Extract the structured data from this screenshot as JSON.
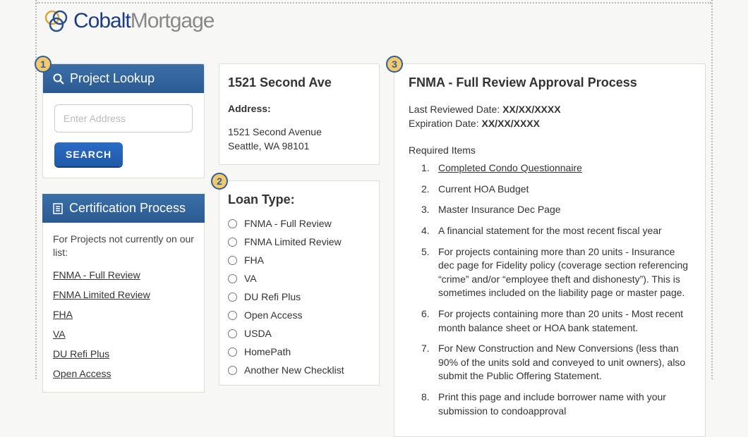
{
  "logo": {
    "cobalt": "Cobalt",
    "mortgage": "Mortgage"
  },
  "sidebar": {
    "lookup_title": "Project Lookup",
    "search_placeholder": "Enter Address",
    "search_button": "SEARCH",
    "cert_title": "Certification Process",
    "cert_intro": "For Projects not currently on our list:",
    "cert_links": [
      "FNMA - Full Review",
      "FNMA Limited Review",
      "FHA",
      "VA",
      "DU Refi Plus",
      "Open Access"
    ]
  },
  "property": {
    "title": "1521 Second Ave",
    "address_label": "Address:",
    "line1": "1521 Second Avenue",
    "line2": "Seattle, WA 98101"
  },
  "loan": {
    "title": "Loan Type:",
    "options": [
      "FNMA - Full Review",
      "FNMA Limited Review",
      "FHA",
      "VA",
      "DU Refi Plus",
      "Open Access",
      "USDA",
      "HomePath",
      "Another New Checklist"
    ]
  },
  "review": {
    "title": "FNMA - Full Review Approval Process",
    "last_reviewed_label": "Last Reviewed Date: ",
    "last_reviewed": "XX/XX/XXXX",
    "expiration_label": "Expiration Date: ",
    "expiration": "XX/XX/XXXX",
    "required_title": "Required Items",
    "items": [
      "Completed  Condo Questionnaire",
      "Current HOA Budget",
      "Master Insurance Dec Page",
      "A financial statement for the most recent fiscal year",
      "For projects containing more than 20 units - Insurance dec page for Fidelity policy (coverage section referencing “crime” and/or “employee theft and dishonesty”).  This is sometimes included on the liability page or master page.",
      "For projects containing more than 20 units - Most recent month balance sheet or HOA bank statement.",
      "For New Construction and New Conversions (less than 90% of the units sold and conveyed to unit owners), also submit the Public Offering Statement.",
      "Print this page and include borrower name with your submission to condoapproval"
    ]
  },
  "badges": {
    "one": "1",
    "two": "2",
    "three": "3"
  }
}
